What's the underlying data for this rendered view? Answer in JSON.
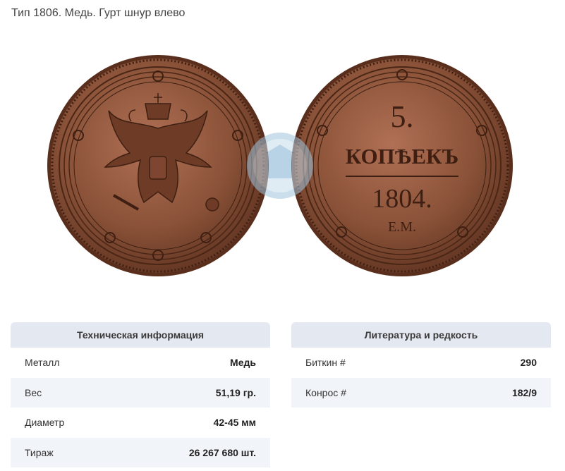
{
  "page": {
    "title": "Тип 1806. Медь. Гурт шнур влево"
  },
  "coin": {
    "obverse": {
      "emblem": "double-headed-eagle"
    },
    "reverse": {
      "denomination": "5.",
      "currency": "КОПѢЕКЪ",
      "year": "1804.",
      "mint": "Е.М."
    },
    "colors": {
      "copper": "#8a5238",
      "copper_dark": "#4a2616",
      "copper_light": "#b4755a"
    }
  },
  "technical": {
    "header": "Техническая информация",
    "rows": [
      {
        "label": "Металл",
        "value": "Медь"
      },
      {
        "label": "Вес",
        "value": "51,19 гр."
      },
      {
        "label": "Диаметр",
        "value": "42-45 мм"
      },
      {
        "label": "Тираж",
        "value": "26 267 680 шт."
      }
    ]
  },
  "literature": {
    "header": "Литература и редкость",
    "rows": [
      {
        "label": "Биткин #",
        "value": "290"
      },
      {
        "label": "Конрос #",
        "value": "182/9"
      }
    ]
  }
}
